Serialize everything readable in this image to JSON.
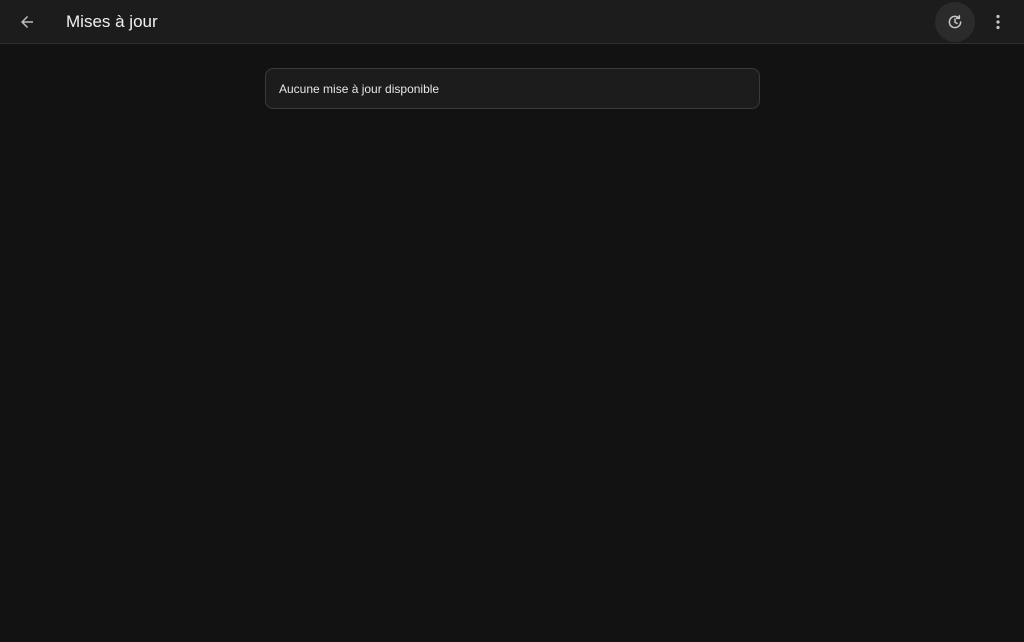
{
  "header": {
    "title": "Mises à jour",
    "back_icon": "arrow-left-icon",
    "refresh_icon": "refresh-history-icon",
    "more_icon": "more-vertical-icon"
  },
  "main": {
    "message": "Aucune mise à jour disponible"
  },
  "colors": {
    "background": "#121212",
    "topbar": "#1c1c1c",
    "card": "#1c1c1c",
    "card_border": "#3a3a3a",
    "icon": "#bdbdbd"
  }
}
